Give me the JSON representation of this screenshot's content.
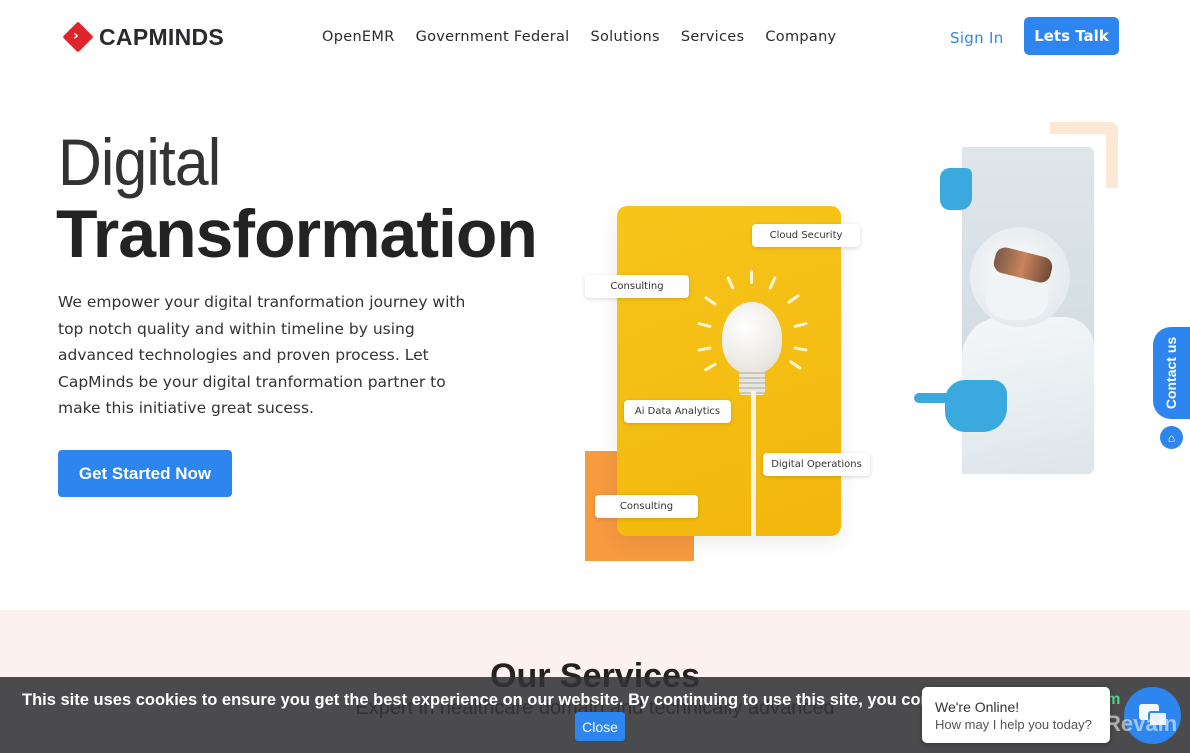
{
  "header": {
    "logo_text": "CAPMINDS",
    "logo_icon": "chevron-right-icon",
    "nav": [
      "OpenEMR",
      "Government Federal",
      "Solutions",
      "Services",
      "Company"
    ],
    "sign_in": "Sign In",
    "cta": "Lets Talk"
  },
  "hero": {
    "title_line1": "Digital",
    "title_line2": "Transformation",
    "description": "We empower your digital tranformation journey with top notch quality and within timeline by using advanced technologies and proven process. Let CapMinds be your digital tranformation partner to make this initiative great sucess.",
    "cta": "Get Started Now",
    "tags": [
      "Cloud Security",
      "Consulting",
      "Ai Data Analytics",
      "Digital Operations",
      "Consulting"
    ]
  },
  "side": {
    "contact_tab": "Contact us",
    "home_icon": "home-icon"
  },
  "services": {
    "title": "Our Services",
    "subtitle": "Expert in healthcare domain and technically advanced"
  },
  "cookie": {
    "text": "This site uses cookies to ensure you get the best experience on our website. By continuing to use this site, you consent to the",
    "link_fragment": "rm",
    "close": "Close"
  },
  "chat": {
    "line1": "We're Online!",
    "line2": "How may I help you today?",
    "launcher_icon": "chat-bubbles-icon"
  },
  "watermark": "Revain",
  "colors": {
    "brand_blue": "#2d86f0",
    "logo_red": "#e0242b",
    "card_yellow": "#f5c013",
    "accent_orange": "#f79a40"
  }
}
